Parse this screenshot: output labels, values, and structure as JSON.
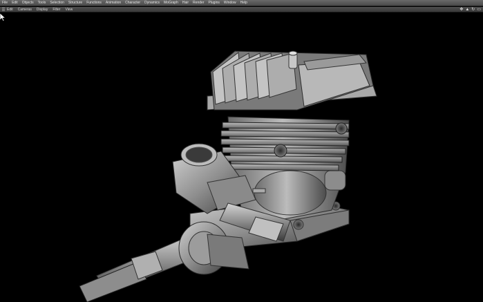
{
  "menu": {
    "items": [
      "File",
      "Edit",
      "Objects",
      "Tools",
      "Selection",
      "Structure",
      "Functions",
      "Animation",
      "Character",
      "Dynamics",
      "MoGraph",
      "Hair",
      "Render",
      "Plugins",
      "Window",
      "Help"
    ]
  },
  "viewport_menu": {
    "items": [
      "Edit",
      "Cameras",
      "Display",
      "Filter",
      "View"
    ]
  },
  "nav_icons": [
    "move-view-icon",
    "zoom-view-icon",
    "rotate-view-icon",
    "maximize-view-icon"
  ],
  "colors": {
    "menubar": "#5a5a5a",
    "viewport_background": "#000000",
    "model": "#9a9a9a"
  }
}
